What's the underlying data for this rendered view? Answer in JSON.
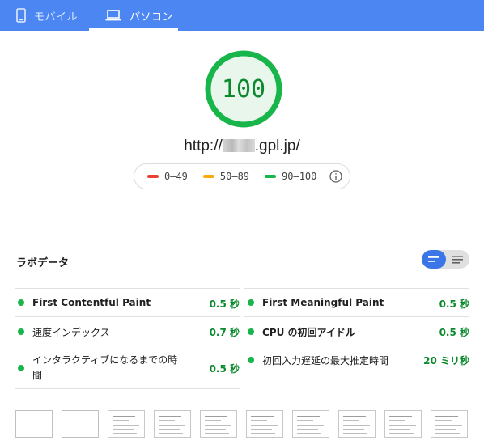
{
  "tabs": [
    {
      "label": "モバイル",
      "icon": "smartphone-icon",
      "selected": false
    },
    {
      "label": "パソコン",
      "icon": "laptop-icon",
      "selected": true
    }
  ],
  "score": {
    "value": "100",
    "color": "#18b64a"
  },
  "url": {
    "prefix": "http://",
    "suffix": ".gpl.jp/"
  },
  "legend": {
    "items": [
      {
        "range": "0–49",
        "color": "#e94235"
      },
      {
        "range": "50–89",
        "color": "#fbab0d"
      },
      {
        "range": "90–100",
        "color": "#18b64a"
      }
    ],
    "info_icon": "info-icon"
  },
  "lab": {
    "title": "ラボデータ",
    "metrics_left": [
      {
        "label": "First Contentful Paint",
        "value": "0.5 秒"
      },
      {
        "label": "速度インデックス",
        "value": "0.7 秒"
      },
      {
        "label_line1": "インタラクティブになるまでの時",
        "label_line2": "間",
        "value": "0.5 秒"
      }
    ],
    "metrics_right": [
      {
        "label": "First Meaningful Paint",
        "value": "0.5 秒"
      },
      {
        "label": "CPU の初回アイドル",
        "value": "0.5 秒"
      },
      {
        "label": "初回入力遅延の最大推定時間",
        "value": "20 ミリ秒"
      }
    ]
  },
  "colors": {
    "accent": "#4b86f3",
    "pass": "#18b64a",
    "pass_text": "#0b8a2d"
  }
}
